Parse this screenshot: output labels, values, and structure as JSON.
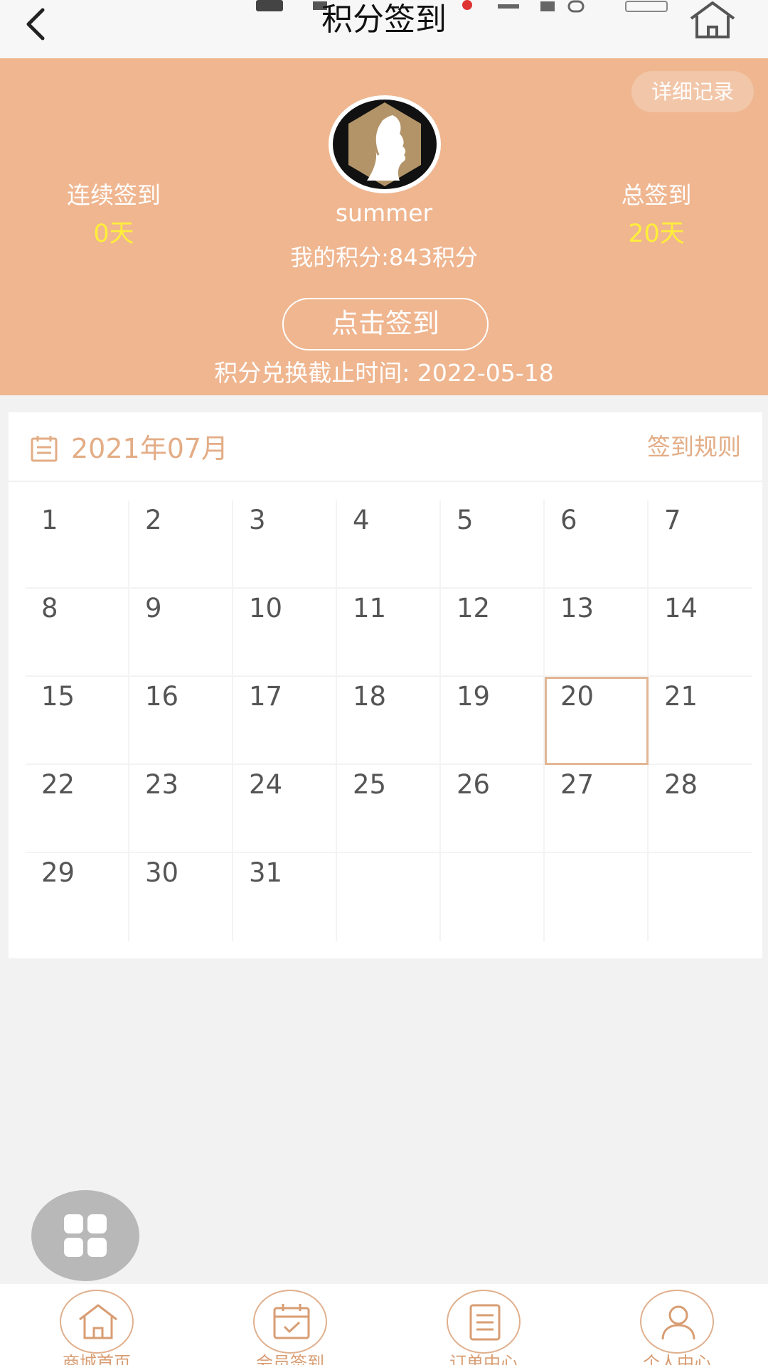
{
  "nav": {
    "title": "积分签到"
  },
  "header": {
    "detail_button": "详细记录",
    "username": "summer",
    "consecutive": {
      "label": "连续签到",
      "value": "0天"
    },
    "total": {
      "label": "总签到",
      "value": "20天"
    },
    "points_text": "我的积分:843积分",
    "signin_button": "点击签到",
    "deadline_text": "积分兑换截止时间: 2022-05-18"
  },
  "calendar": {
    "month": "2021年07月",
    "rules_link": "签到规则",
    "today": "20",
    "rows": [
      [
        "1",
        "2",
        "3",
        "4",
        "5",
        "6",
        "7"
      ],
      [
        "8",
        "9",
        "10",
        "11",
        "12",
        "13",
        "14"
      ],
      [
        "15",
        "16",
        "17",
        "18",
        "19",
        "20",
        "21"
      ],
      [
        "22",
        "23",
        "24",
        "25",
        "26",
        "27",
        "28"
      ],
      [
        "29",
        "30",
        "31",
        "",
        "",
        "",
        ""
      ]
    ]
  },
  "tabs": [
    {
      "label": "商城首页",
      "icon": "home-icon"
    },
    {
      "label": "会员签到",
      "icon": "calendar-check-icon"
    },
    {
      "label": "订单中心",
      "icon": "document-icon"
    },
    {
      "label": "个人中心",
      "icon": "user-icon"
    }
  ],
  "colors": {
    "header_bg": "#efb690",
    "accent": "#e3ad86",
    "stat_value": "#ffee3a"
  }
}
